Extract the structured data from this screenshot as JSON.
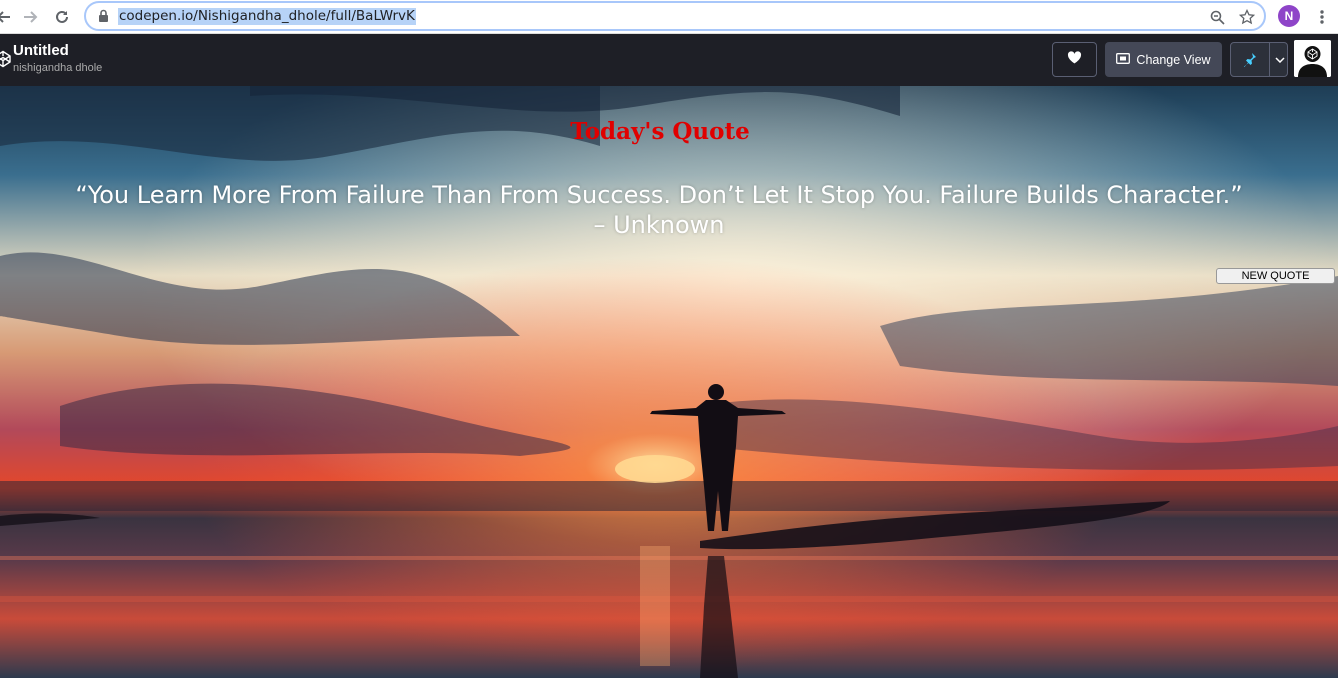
{
  "browser": {
    "url": "codepen.io/Nishigandha_dhole/full/BaLWrvK",
    "profile_initial": "N"
  },
  "codepen": {
    "title": "Untitled",
    "author": "nishigandha dhole",
    "change_view_label": "Change View"
  },
  "page": {
    "heading": "Today's Quote",
    "quote_text": "“You Learn More From Failure Than From Success. Don’t Let It Stop You. Failure Builds Character.”",
    "quote_author": "– Unknown",
    "new_quote_label": "NEW QUOTE"
  },
  "colors": {
    "heading": "#e00000",
    "header_bg": "#1e1f26",
    "profile": "#8e44c8"
  },
  "icons": [
    "back-icon",
    "forward-icon",
    "reload-icon",
    "lock-icon",
    "zoom-icon",
    "star-icon",
    "kebab-menu-icon",
    "codepen-logo-icon",
    "heart-icon",
    "change-view-icon",
    "pin-icon",
    "chevron-down-icon",
    "user-avatar"
  ]
}
